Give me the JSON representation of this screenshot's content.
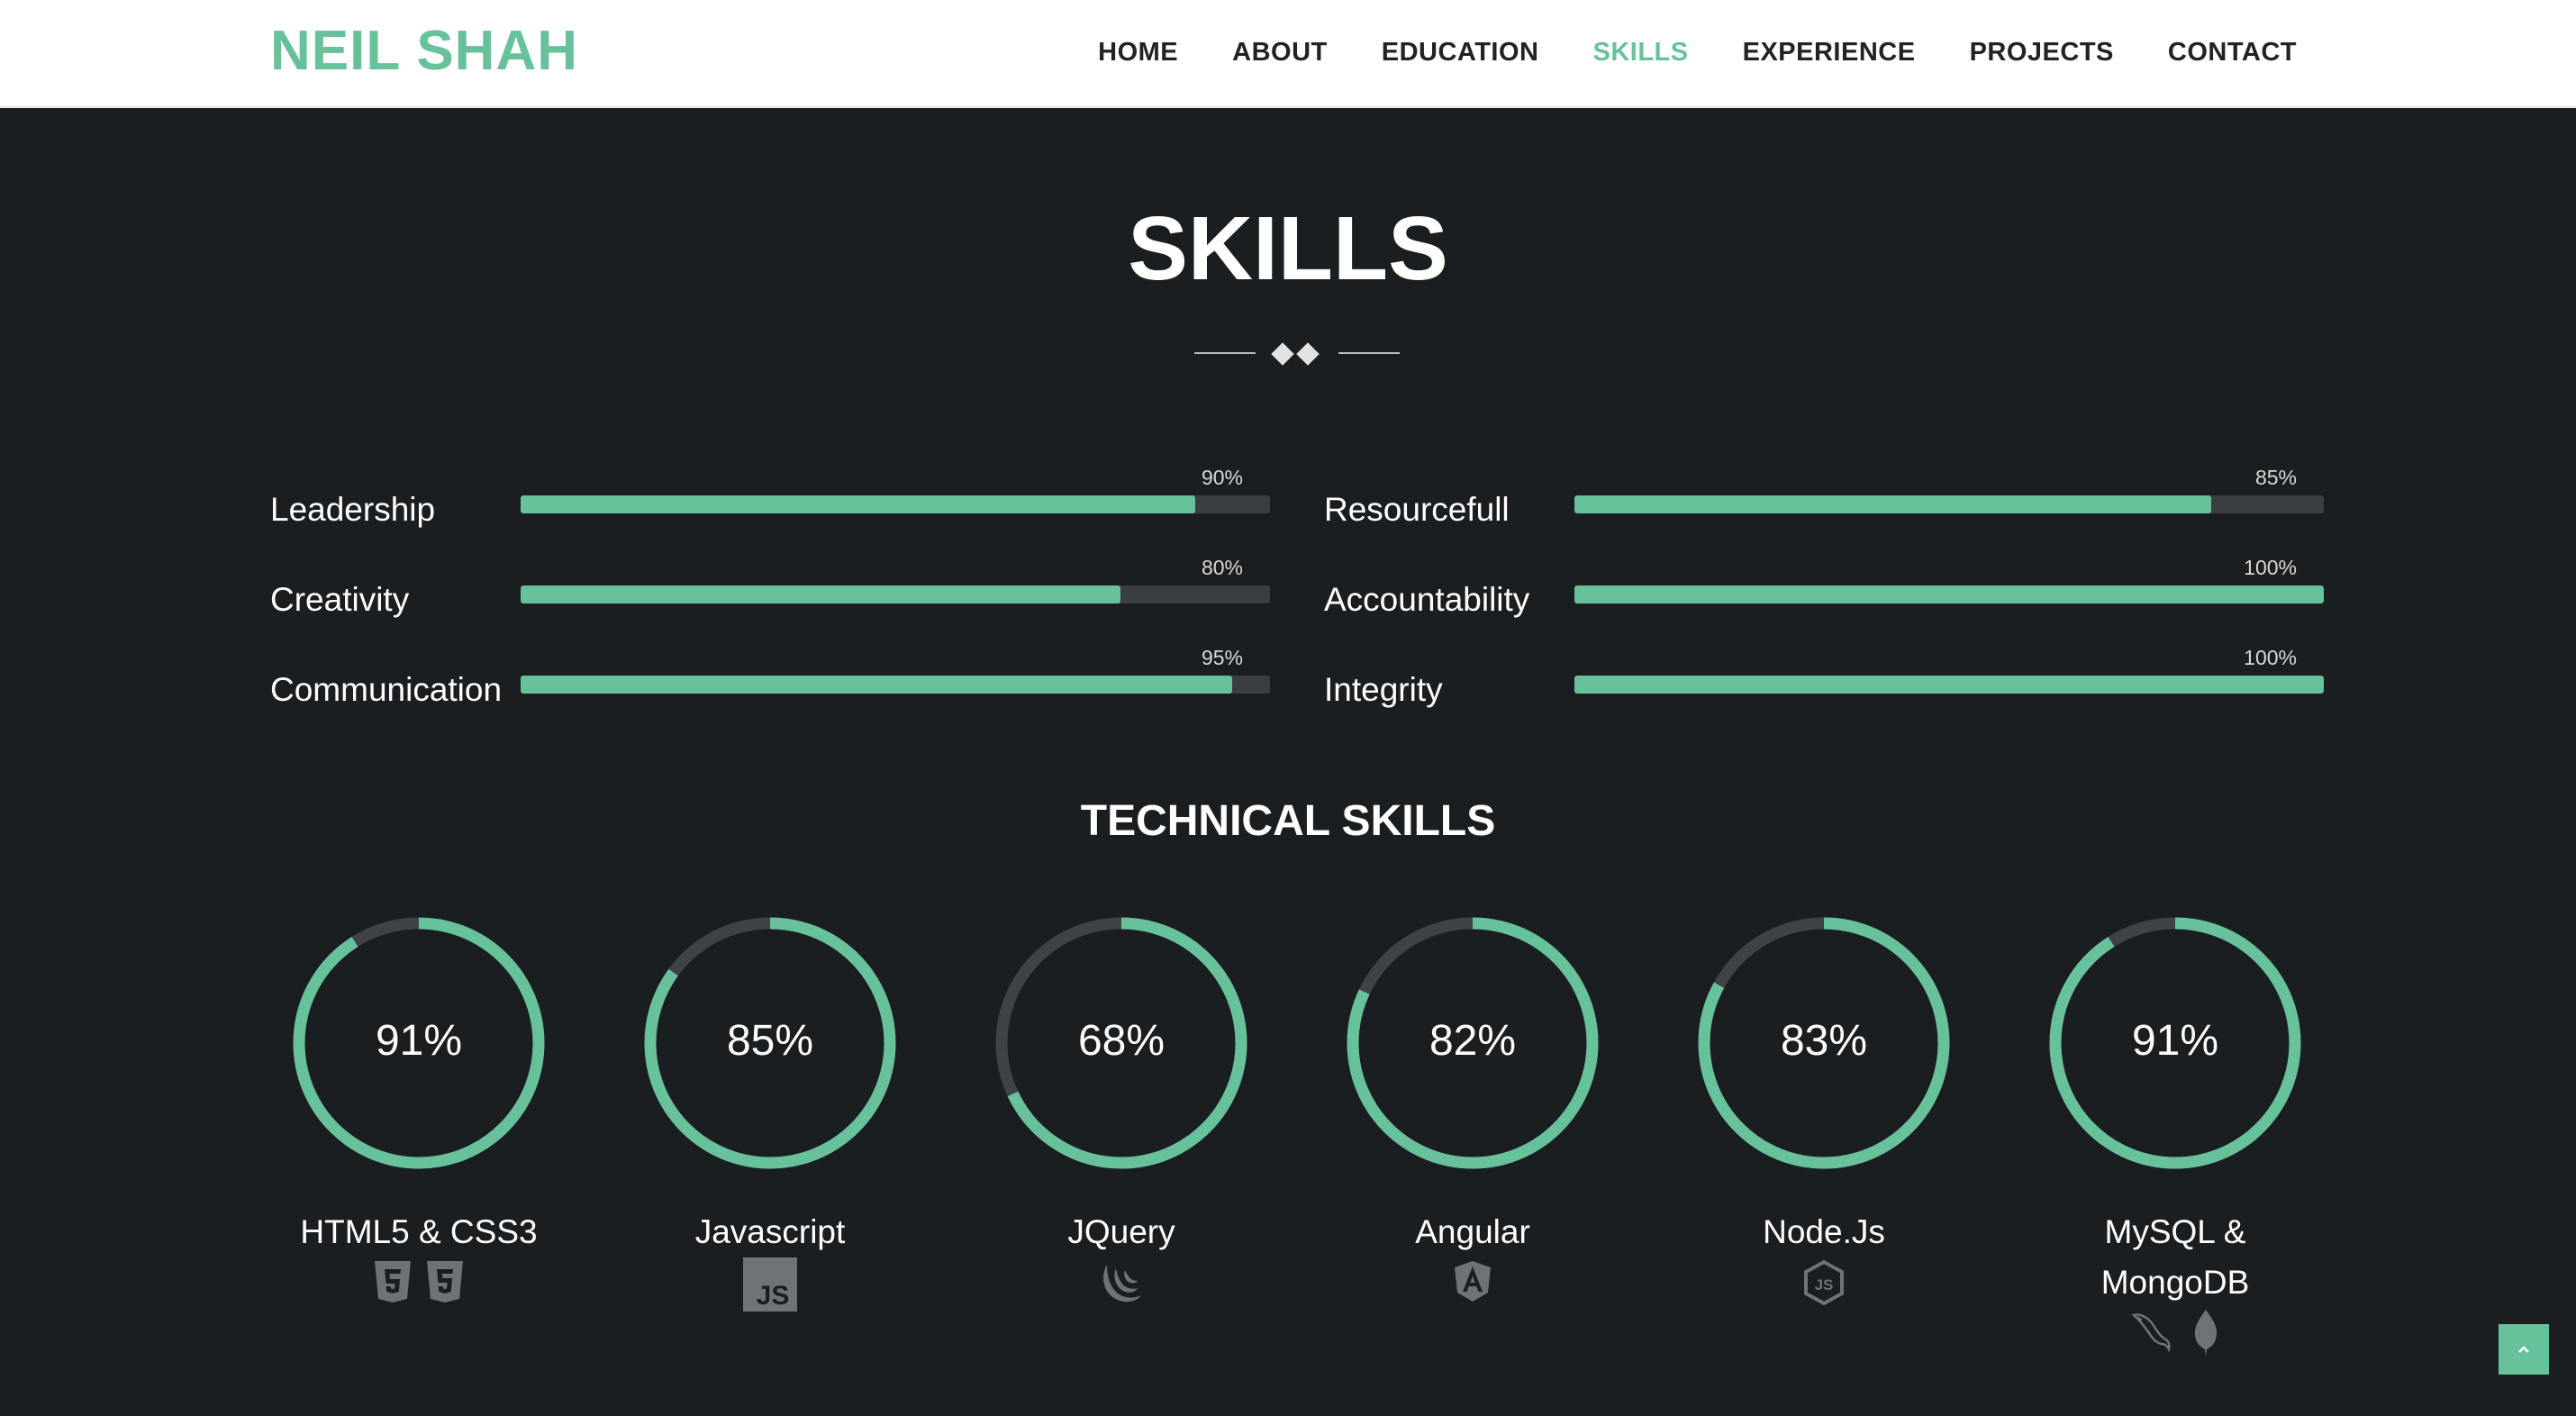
{
  "brand": "NEIL SHAH",
  "nav": [
    "HOME",
    "ABOUT",
    "EDUCATION",
    "SKILLS",
    "EXPERIENCE",
    "PROJECTS",
    "CONTACT"
  ],
  "nav_active": "SKILLS",
  "section_title": "SKILLS",
  "soft_skills": [
    {
      "name": "Leadership",
      "percent": 90,
      "label": "90%"
    },
    {
      "name": "Creativity",
      "percent": 80,
      "label": "80%"
    },
    {
      "name": "Communication",
      "percent": 95,
      "label": "95%"
    },
    {
      "name": "Resourcefull",
      "percent": 85,
      "label": "85%"
    },
    {
      "name": "Accountability",
      "percent": 100,
      "label": "100%"
    },
    {
      "name": "Integrity",
      "percent": 100,
      "label": "100%"
    }
  ],
  "tech_title": "TECHNICAL SKILLS",
  "tech_skills": [
    {
      "name": "HTML5 & CSS3",
      "percent": 91,
      "label": "91%",
      "icons": [
        "html5-icon",
        "css3-icon"
      ]
    },
    {
      "name": "Javascript",
      "percent": 85,
      "label": "85%",
      "icons": [
        "javascript-icon"
      ]
    },
    {
      "name": "JQuery",
      "percent": 68,
      "label": "68%",
      "icons": [
        "jquery-icon"
      ]
    },
    {
      "name": "Angular",
      "percent": 82,
      "label": "82%",
      "icons": [
        "angular-icon"
      ]
    },
    {
      "name": "Node.Js",
      "percent": 83,
      "label": "83%",
      "icons": [
        "nodejs-icon"
      ]
    },
    {
      "name": "MySQL & MongoDB",
      "percent": 91,
      "label": "91%",
      "icons": [
        "mysql-icon",
        "mongodb-icon"
      ]
    }
  ],
  "colors": {
    "accent": "#67c29c",
    "background": "#1b1e21",
    "track": "#3a3d41",
    "nav_bg": "#ffffff"
  }
}
